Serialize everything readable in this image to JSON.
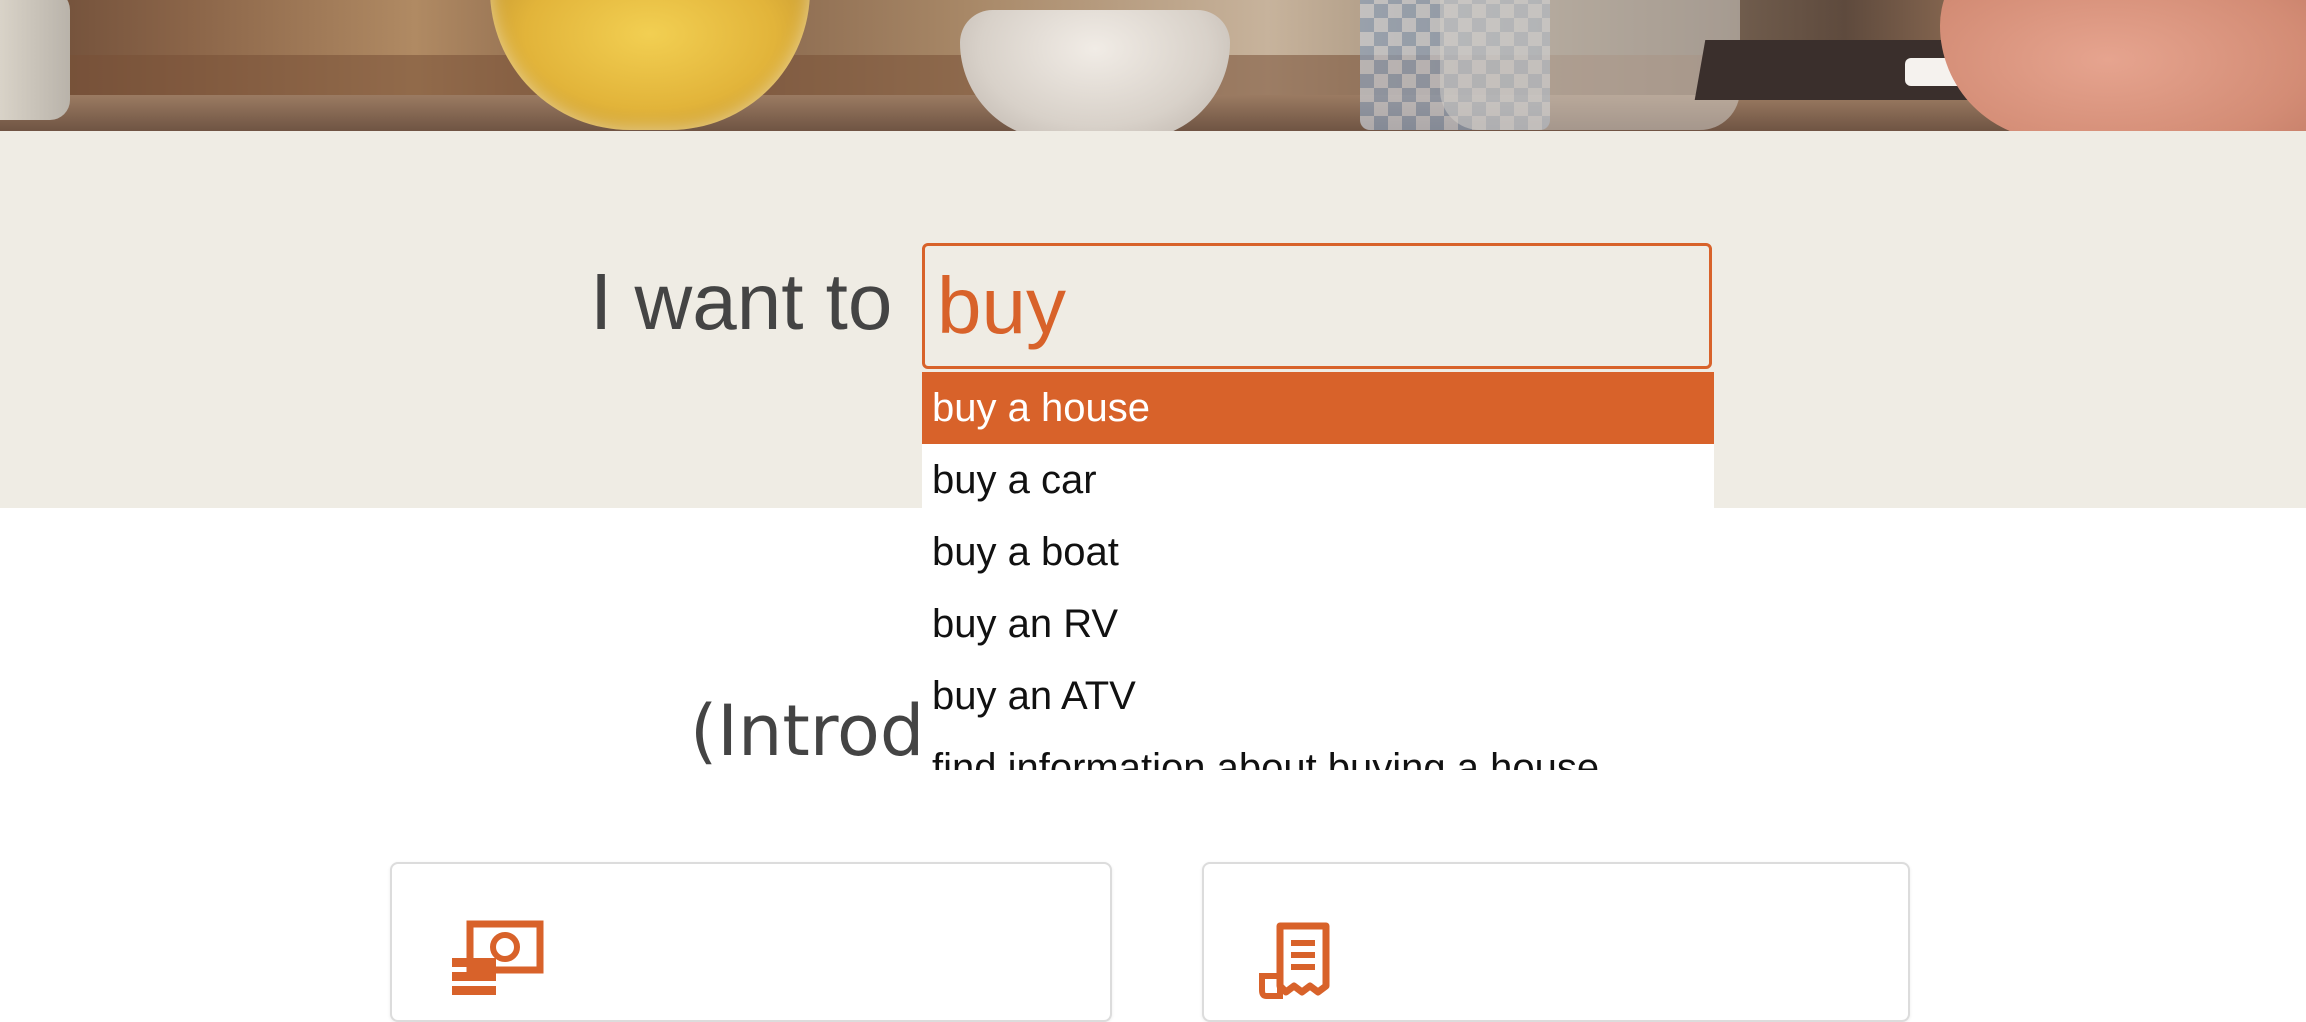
{
  "search": {
    "prompt_label": "I want to",
    "query": "buy",
    "suggestions": [
      {
        "label": "buy a house",
        "active": true
      },
      {
        "label": "buy a car"
      },
      {
        "label": "buy a boat"
      },
      {
        "label": "buy an RV"
      },
      {
        "label": "buy an ATV"
      },
      {
        "label": "find information about buying a house"
      }
    ]
  },
  "intro": {
    "heading": "(Introdu"
  },
  "cards": [
    {
      "icon": "money-icon"
    },
    {
      "icon": "receipt-icon"
    }
  ],
  "colors": {
    "accent": "#d8622a",
    "band_bg": "#efece4",
    "text_dark": "#444444"
  }
}
